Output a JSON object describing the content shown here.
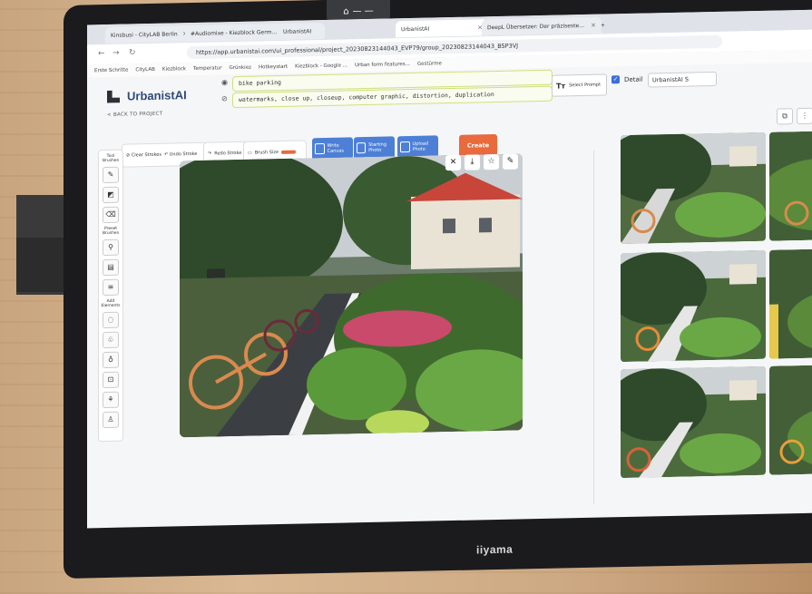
{
  "browser": {
    "tabs": [
      {
        "label": "Kinsbusi - CityLAB Berlin"
      },
      {
        "label": "#Audiomixe - Kiezblock Germ..."
      },
      {
        "label": "UrbanistAI"
      },
      {
        "label": "UrbanistAI"
      },
      {
        "label": "DeepL Übersetzer: Der präziseste..."
      }
    ],
    "url": "https://app.urbanistai.com/ui_professional/project_20230823144043_EVP79/group_20230823144043_BSP3VJ",
    "bookmarks": [
      "Erste Schritte",
      "CityLAB",
      "Kiezblock",
      "Temperatur",
      "Grünkiez",
      "Hotkeystart",
      "Kiezblock - Google ...",
      "Urban form features...",
      "Gestürme"
    ]
  },
  "app": {
    "title": "UrbanistAI",
    "back_label": "< BACK TO PROJECT",
    "prompt_positive": "bike parking",
    "prompt_negative": "watermarks, close up, closeup, computer graphic, distortion, duplication",
    "select_prompt_label": "Select Prompt",
    "detail_label": "Detail",
    "model_value": "UrbanistAI S",
    "create_label": "Create",
    "toolbar": {
      "clear_strokes": "Clear Strokes",
      "undo_stroke": "Undo Stroke",
      "redo_stroke": "Redo Stroke",
      "brush_size": "Brush Size",
      "write_canvas": "Write Canvas",
      "starting_photo": "Starting Photo",
      "upload_photo": "Upload Photo"
    },
    "left_groups": {
      "brushes": "Tool Brushes",
      "preset": "Preset Brushes",
      "add": "Add Elements"
    }
  },
  "monitor": {
    "brand": "iiyama"
  },
  "colors": {
    "accent": "#4d7fd6",
    "create": "#e86a3d",
    "prompt_border": "#cfe07a"
  }
}
